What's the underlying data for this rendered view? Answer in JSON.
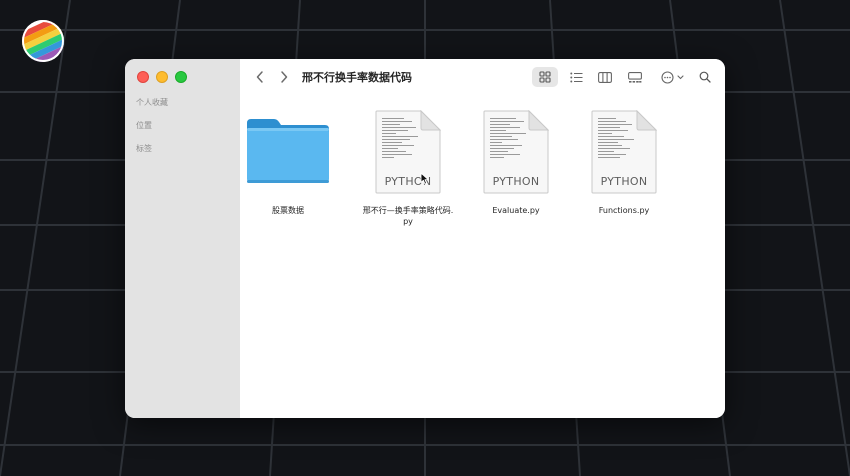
{
  "window": {
    "title": "邢不行换手率数据代码"
  },
  "sidebar": {
    "items": [
      {
        "label": "个人收藏"
      },
      {
        "label": "位置"
      },
      {
        "label": "标签"
      }
    ]
  },
  "toolbar": {
    "icons": [
      "chevron-left-icon",
      "chevron-right-icon",
      "grid-view-icon",
      "list-view-icon",
      "column-view-icon",
      "gallery-view-icon",
      "more-icon",
      "search-icon"
    ]
  },
  "files": [
    {
      "name": "股票数据",
      "kind": "folder"
    },
    {
      "name": "邢不行—换手率策略代码.py",
      "kind": "python",
      "badge": "PYTHON"
    },
    {
      "name": "Evaluate.py",
      "kind": "python",
      "badge": "PYTHON"
    },
    {
      "name": "Functions.py",
      "kind": "python",
      "badge": "PYTHON"
    }
  ],
  "colors": {
    "background": "#121418",
    "sidebar": "#e3e3e3",
    "folder": "#5ab8f0",
    "close": "#fe5f57",
    "minimize": "#febc2e",
    "zoom": "#28c840"
  }
}
